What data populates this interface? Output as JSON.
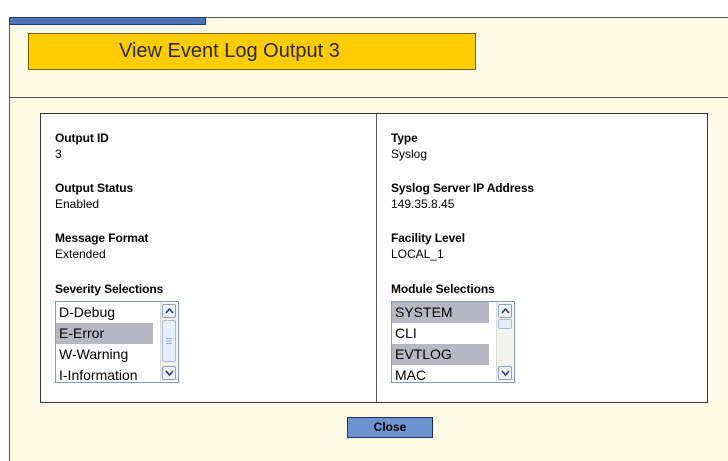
{
  "title": "View Event Log Output 3",
  "left_column": {
    "output_id": {
      "label": "Output ID",
      "value": "3"
    },
    "output_status": {
      "label": "Output Status",
      "value": "Enabled"
    },
    "message_format": {
      "label": "Message Format",
      "value": "Extended"
    },
    "severity": {
      "label": "Severity Selections",
      "options": [
        {
          "text": "D-Debug",
          "selected": false
        },
        {
          "text": "E-Error",
          "selected": true
        },
        {
          "text": "W-Warning",
          "selected": false
        },
        {
          "text": "I-Information",
          "selected": false
        }
      ]
    }
  },
  "right_column": {
    "type": {
      "label": "Type",
      "value": "Syslog"
    },
    "server_ip": {
      "label": "Syslog Server IP Address",
      "value": "149.35.8.45"
    },
    "facility": {
      "label": "Facility Level",
      "value": "LOCAL_1"
    },
    "modules": {
      "label": "Module Selections",
      "options": [
        {
          "text": "SYSTEM",
          "selected": true
        },
        {
          "text": "CLI",
          "selected": false
        },
        {
          "text": "EVTLOG",
          "selected": true
        },
        {
          "text": "MAC",
          "selected": false
        }
      ]
    }
  },
  "close_label": "Close",
  "colors": {
    "title_tab": "#ffcc00",
    "top_bar": "#4e73b8",
    "page_background": "#fffbe7",
    "close_button": "#6d93d1",
    "selected_option": "#b8b8c4"
  }
}
